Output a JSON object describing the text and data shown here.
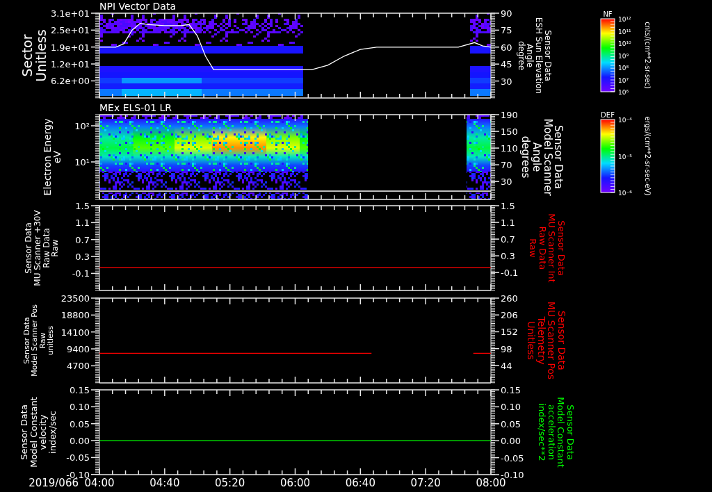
{
  "panels": [
    {
      "kind": "bands",
      "left_axis": {
        "kind": "linear",
        "label": "Sector\nUnitless",
        "ticks": [
          "3.1e+01",
          "2.5e+01",
          "1.9e+01",
          "1.2e+01",
          "6.2e+00"
        ]
      },
      "chart_data": {
        "type": "line",
        "title": "NPI Vector Data",
        "ylabel": "Sensor Data\nESH Sun Elevation\nAngle\ndegree",
        "x": [
          4,
          4.1667,
          4.25,
          4.3333,
          4.4167,
          4.5,
          4.6667,
          4.8333,
          4.9167,
          5,
          5.0833,
          5.1667,
          5.3333,
          6.1667,
          6.3333,
          6.5,
          6.6667,
          6.8333,
          7.6667,
          7.8333,
          7.9167,
          8
        ],
        "series": [
          {
            "color": "#ffffff",
            "values": [
              60,
              60,
              63,
              75,
              81,
              80,
              79,
              79,
              80,
              70,
              52,
              40,
              40,
              40,
              44,
              52,
              58,
              60,
              60,
              64,
              61,
              60
            ]
          }
        ],
        "xlim": [
          4,
          8
        ],
        "ylim": [
          15,
          90
        ],
        "yticks": [
          90,
          75,
          60,
          45,
          30
        ]
      },
      "colorbar": {
        "title": "NF",
        "ticks": [
          "10¹²",
          "10¹¹",
          "10¹⁰",
          "10⁹",
          "10⁸",
          "10⁷",
          "10⁶"
        ],
        "units": "cnts/(cm**2-sr-sec)"
      }
    },
    {
      "kind": "spectrum",
      "left_axis": {
        "kind": "log",
        "label": "Electron Energy\neV",
        "ticks": [
          "10²",
          "10¹"
        ]
      },
      "chart_data": {
        "type": "line",
        "title": "MEx ELS-01 LR",
        "ylabel": "Sensor Data\nModel Scanner\nAngle\ndegrees",
        "x": [
          4,
          8
        ],
        "series": [
          {
            "color": "#ffffff",
            "values": [
              7,
              7
            ]
          }
        ],
        "xlim": [
          4,
          8
        ],
        "ylim": [
          -13,
          190
        ],
        "yticks": [
          190,
          150,
          110,
          70,
          30
        ]
      },
      "colorbar": {
        "title": "DEF",
        "ticks": [
          "10⁻⁴",
          "10⁻⁵",
          "10⁻⁶"
        ],
        "units": "ergs/(cm**2-sr-sec-eV)"
      }
    },
    {
      "kind": "line",
      "left_axis": {
        "kind": "linear",
        "label": "Sensor Data\nMU Scanner +30V\nRaw Data\nRaw",
        "ticks": [
          "1.5",
          "1.1",
          "0.7",
          "0.3",
          "-0.1"
        ]
      },
      "chart_data": {
        "type": "line",
        "ylabel": "Sensor Data\nMU Scanner Int\nRaw Data\nRaw",
        "x": [
          4,
          8
        ],
        "series": [
          {
            "color": "#ff0000",
            "values": [
              0.02,
              0.02
            ]
          }
        ],
        "xlim": [
          4,
          8
        ],
        "ylim": [
          -0.53,
          1.5
        ],
        "yticks": [
          {
            "value": 1.5,
            "label": "1.5"
          },
          {
            "value": 1.1,
            "label": "1.1"
          },
          {
            "value": 0.7,
            "label": "0.7"
          },
          {
            "value": 0.3,
            "label": "0.3"
          },
          {
            "value": -0.1,
            "label": "-0.1"
          }
        ]
      }
    },
    {
      "kind": "line",
      "left_axis": {
        "kind": "linear",
        "label": "Sensor Data\nModel Scanner Pos\nRaw\nunitless",
        "ticks": [
          "23500",
          "18800",
          "14100",
          "9400",
          "4700"
        ]
      },
      "chart_data": {
        "type": "line",
        "ylabel": "Sensor Data\nMU Scanner Pos\nTelemetry\nUnitless",
        "x": [
          4,
          6.78,
          6.8,
          7.82,
          8
        ],
        "series": [
          {
            "color": "#ff0000",
            "values": [
              83,
              83,
              null,
              83,
              83
            ]
          }
        ],
        "xlim": [
          4,
          8
        ],
        "ylim": [
          -12,
          260
        ],
        "yticks": [
          260,
          206,
          152,
          98,
          44
        ]
      }
    },
    {
      "kind": "line",
      "left_axis": {
        "kind": "linear",
        "label": "Sensor Data\nModel Constant\nvelocity\nindex/sec",
        "ticks": [
          "0.15",
          "0.10",
          "0.05",
          "0.00",
          "-0.05",
          "-0.10"
        ]
      },
      "chart_data": {
        "type": "line",
        "ylabel": "Sensor Data\nModel Constant\nacceleration\nindex/sec**2",
        "x": [
          4,
          8
        ],
        "series": [
          {
            "color": "#00ff00",
            "values": [
              0,
              0
            ]
          }
        ],
        "xlim": [
          4,
          8
        ],
        "ylim": [
          -0.1,
          0.15
        ],
        "yticks": [
          {
            "value": 0.15,
            "label": "0.15"
          },
          {
            "value": 0.1,
            "label": "0.10"
          },
          {
            "value": 0.05,
            "label": "0.05"
          },
          {
            "value": 0,
            "label": "0.00"
          },
          {
            "value": -0.05,
            "label": "-0.05"
          },
          {
            "value": -0.1,
            "label": "-0.10"
          }
        ],
        "xticks": [
          {
            "value": 4,
            "label": "04:00"
          },
          {
            "value": 4.6667,
            "label": "04:40"
          },
          {
            "value": 5.3333,
            "label": "05:20"
          },
          {
            "value": 6,
            "label": "06:00"
          },
          {
            "value": 6.6667,
            "label": "06:40"
          },
          {
            "value": 7.3333,
            "label": "07:20"
          },
          {
            "value": 8,
            "label": "08:00"
          }
        ]
      }
    }
  ],
  "date": "2019/066"
}
